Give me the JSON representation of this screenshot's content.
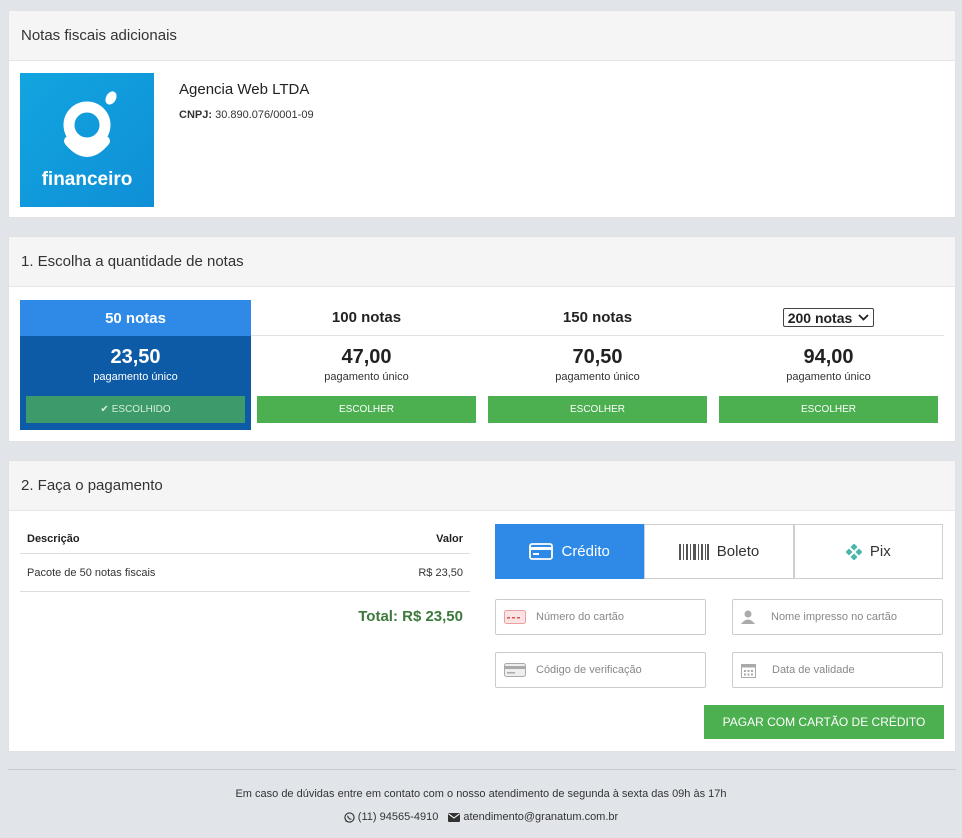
{
  "invoice_panel": {
    "title": "Notas fiscais adicionais",
    "logo_text": "financeiro",
    "company_name": "Agencia Web LTDA",
    "cnpj_label": "CNPJ:",
    "cnpj_value": "30.890.076/0001-09"
  },
  "quantity_panel": {
    "title": "1. Escolha a quantidade de notas",
    "plans": [
      {
        "label": "50 notas",
        "price": "23,50",
        "sub": "pagamento único",
        "button": "ESCOLHIDO",
        "selected": true
      },
      {
        "label": "100 notas",
        "price": "47,00",
        "sub": "pagamento único",
        "button": "ESCOLHER",
        "selected": false
      },
      {
        "label": "150 notas",
        "price": "70,50",
        "sub": "pagamento único",
        "button": "ESCOLHER",
        "selected": false
      },
      {
        "label": "200 notas",
        "price": "94,00",
        "sub": "pagamento único",
        "button": "ESCOLHER",
        "selected": false,
        "dropdown": true
      }
    ]
  },
  "payment_panel": {
    "title": "2. Faça o pagamento",
    "table": {
      "col_desc": "Descrição",
      "col_value": "Valor",
      "rows": [
        {
          "desc": "Pacote de 50 notas fiscais",
          "value": "R$ 23,50"
        }
      ],
      "total": "Total: R$ 23,50"
    },
    "tabs": [
      {
        "label": "Crédito",
        "icon": "credit-card-icon",
        "active": true
      },
      {
        "label": "Boleto",
        "icon": "barcode-icon",
        "active": false
      },
      {
        "label": "Pix",
        "icon": "pix-icon",
        "active": false
      }
    ],
    "fields": {
      "card_number": "Número do cartão",
      "card_name": "Nome impresso no cartão",
      "cvv": "Código de verificação",
      "expiry": "Data de validade"
    },
    "pay_button": "PAGAR COM CARTÃO DE CRÉDITO"
  },
  "footer": {
    "help_text": "Em caso de dúvidas entre em contato com o nosso atendimento de segunda à sexta das 09h às 17h",
    "phone": "(11) 94565-4910",
    "email": "atendimento@granatum.com.br"
  },
  "colors": {
    "accent": "#2e8ae6",
    "selected_bg": "#0d5aa7",
    "green": "#4caf50",
    "total_green": "#3c7a3c"
  }
}
